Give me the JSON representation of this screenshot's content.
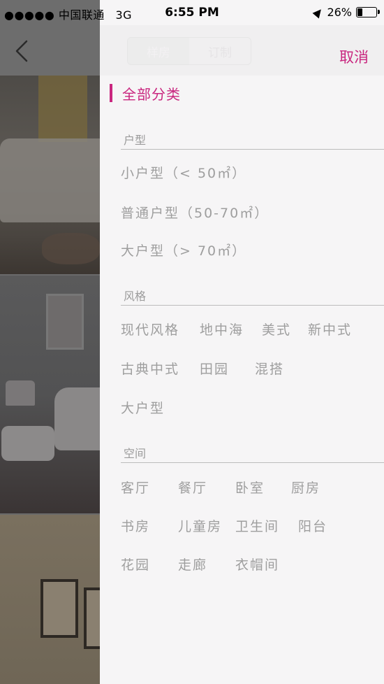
{
  "status_bar": {
    "carrier": "●●●●● 中国联通",
    "network": "3G",
    "time": "6:55 PM",
    "battery": "26%",
    "battery_level": 0.26
  },
  "segments": [
    "样房",
    "订制"
  ],
  "cancel_label": "取消",
  "all_categories": "全部分类",
  "sections": {
    "house_type": {
      "title": "户型",
      "options": [
        "小户型（< 50㎡）",
        "普通户型（50-70㎡）",
        "大户型（> 70㎡）"
      ]
    },
    "style": {
      "title": "风格",
      "options": [
        "现代风格",
        "地中海",
        "美式",
        "新中式",
        "古典中式",
        "田园",
        "混搭",
        "大户型"
      ]
    },
    "space": {
      "title": "空间",
      "options": [
        "客厅",
        "餐厅",
        "卧室",
        "厨房",
        "书房",
        "儿童房",
        "卫生间",
        "阳台",
        "花园",
        "走廊",
        "衣帽间"
      ]
    }
  },
  "colors": {
    "accent": "#c9267f",
    "option_text": "#9e9e9e",
    "drawer_bg": "#f6f5f6"
  }
}
